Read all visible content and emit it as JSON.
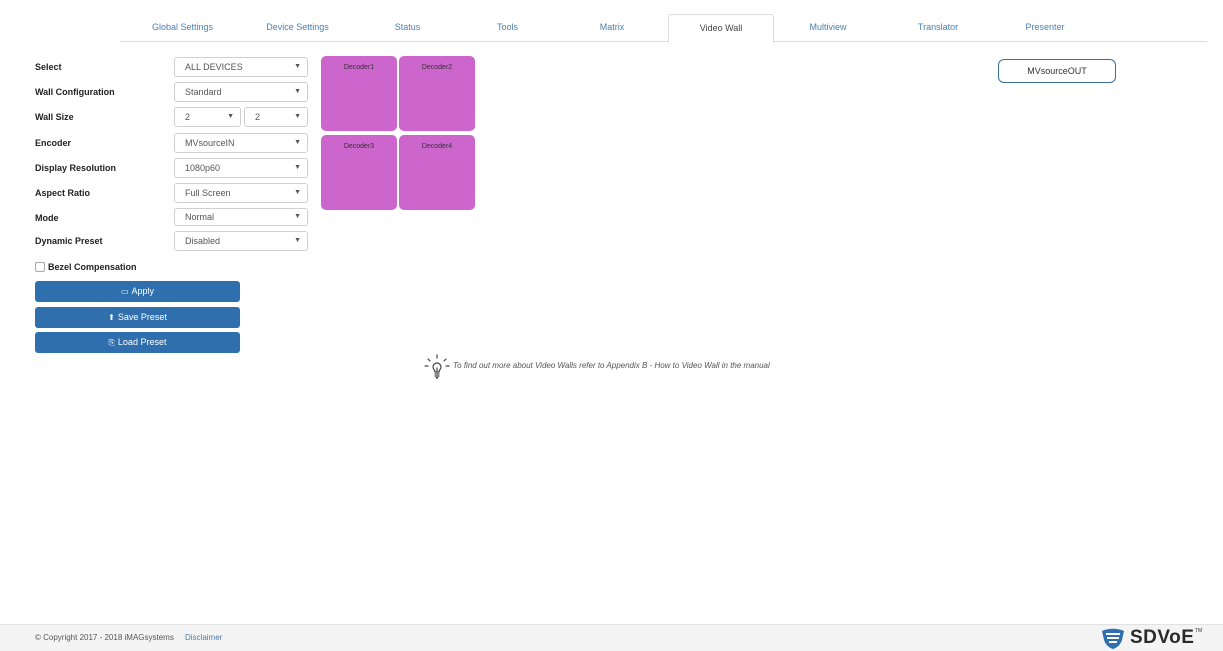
{
  "tabs": [
    {
      "label": "Global Settings"
    },
    {
      "label": "Device Settings"
    },
    {
      "label": "Status"
    },
    {
      "label": "Tools"
    },
    {
      "label": "Matrix"
    },
    {
      "label": "Video Wall",
      "active": true
    },
    {
      "label": "Multiview"
    },
    {
      "label": "Translator"
    },
    {
      "label": "Presenter"
    }
  ],
  "form": {
    "select": {
      "label": "Select",
      "value": "ALL DEVICES"
    },
    "wall_configuration": {
      "label": "Wall Configuration",
      "value": "Standard"
    },
    "wall_size": {
      "label": "Wall Size",
      "rows": "2",
      "cols": "2"
    },
    "encoder": {
      "label": "Encoder",
      "value": "MVsourceIN"
    },
    "display_resolution": {
      "label": "Display Resolution",
      "value": "1080p60"
    },
    "aspect_ratio": {
      "label": "Aspect Ratio",
      "value": "Full Screen"
    },
    "mode": {
      "label": "Mode",
      "value": "Normal"
    },
    "dynamic_preset": {
      "label": "Dynamic Preset",
      "value": "Disabled"
    },
    "bezel_compensation": {
      "label": "Bezel Compensation",
      "checked": false
    }
  },
  "buttons": {
    "apply": "Apply",
    "save_preset": "Save Preset",
    "load_preset": "Load Preset"
  },
  "decoders": [
    "Decoder1",
    "Decoder2",
    "Decoder3",
    "Decoder4"
  ],
  "decoder_color": "#cc66cc",
  "source_button": "MVsourceOUT",
  "tip": "To find out more about Video Walls refer to Appendix B - How to Video Wall in the manual",
  "footer": {
    "copyright": "© Copyright 2017 - 2018 iMAGsystems",
    "disclaimer": "Disclaimer",
    "logo_text": "SDVoE",
    "logo_tm": "TM"
  },
  "colors": {
    "primary_button": "#2f6fad",
    "link": "#4a7fb0"
  }
}
